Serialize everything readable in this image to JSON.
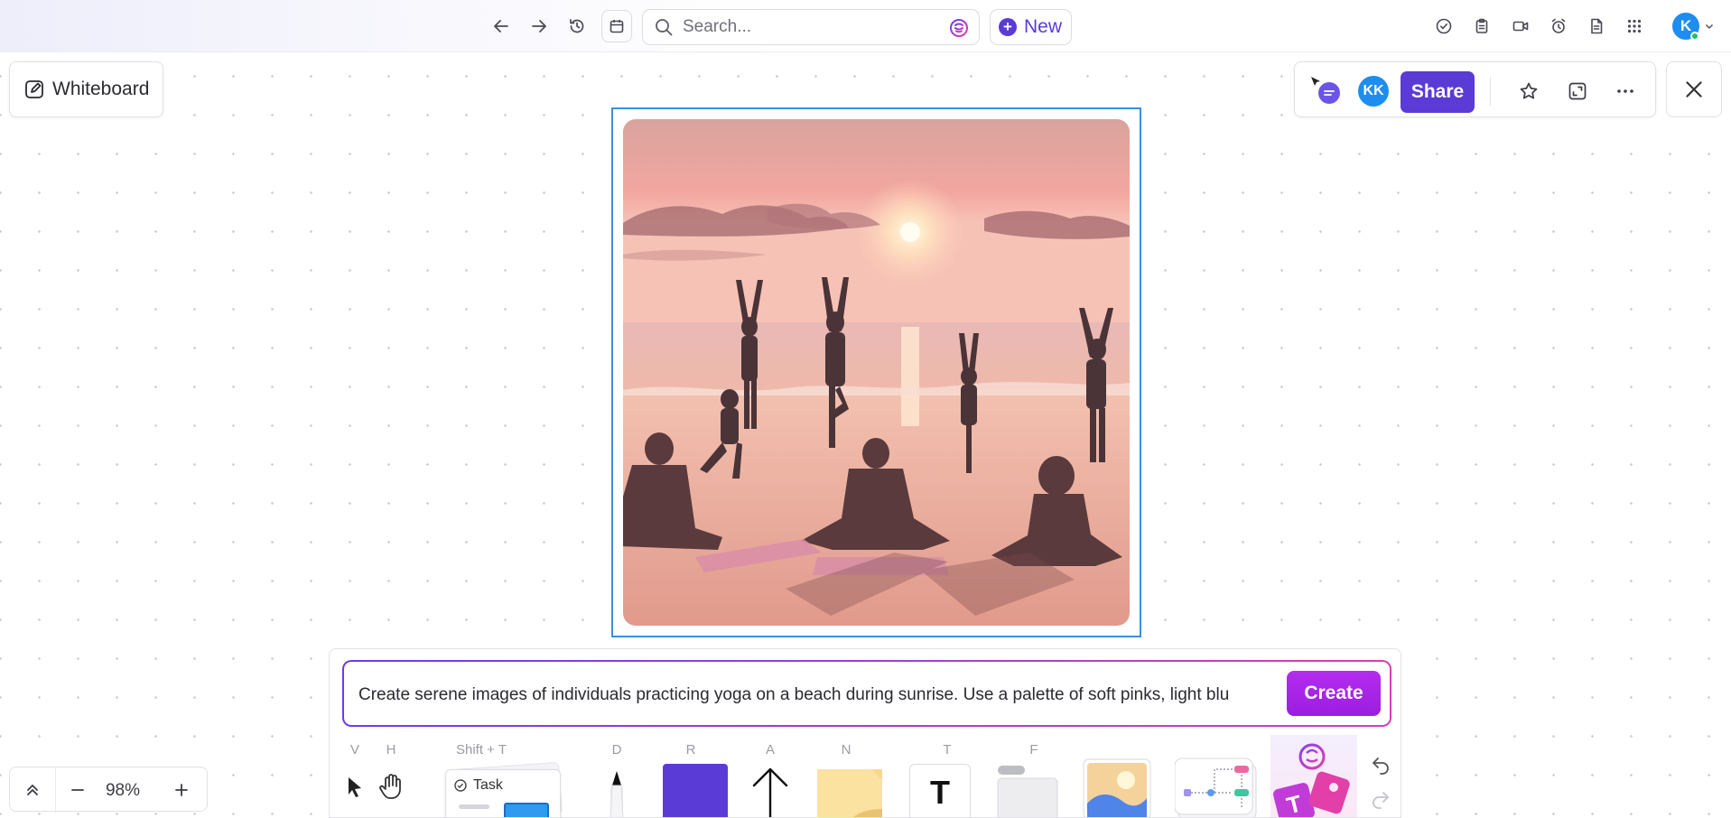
{
  "topbar": {
    "search_placeholder": "Search...",
    "new_label": "New",
    "user_initial": "K"
  },
  "board": {
    "label": "Whiteboard"
  },
  "header_actions": {
    "collaborator_initials": "KK",
    "share_label": "Share"
  },
  "ai_prompt": {
    "text": "Create serene images of individuals practicing yoga on a beach during sunrise. Use a palette of soft pinks, light blu",
    "create_label": "Create"
  },
  "tools": {
    "select_key": "V",
    "hand_key": "H",
    "task_key": "Shift + T",
    "task_label": "Task",
    "draw_key": "D",
    "rect_key": "R",
    "arrow_key": "A",
    "note_key": "N",
    "text_key": "T",
    "frame_key": "F",
    "text_glyph": "T"
  },
  "zoom": {
    "level": "98%"
  },
  "colors": {
    "accent": "#5b3bd6",
    "ai_gradient_start": "#6b3cf0",
    "ai_gradient_end": "#d43fb8",
    "selection": "#3c8fe0",
    "avatar": "#1d8ef0"
  }
}
